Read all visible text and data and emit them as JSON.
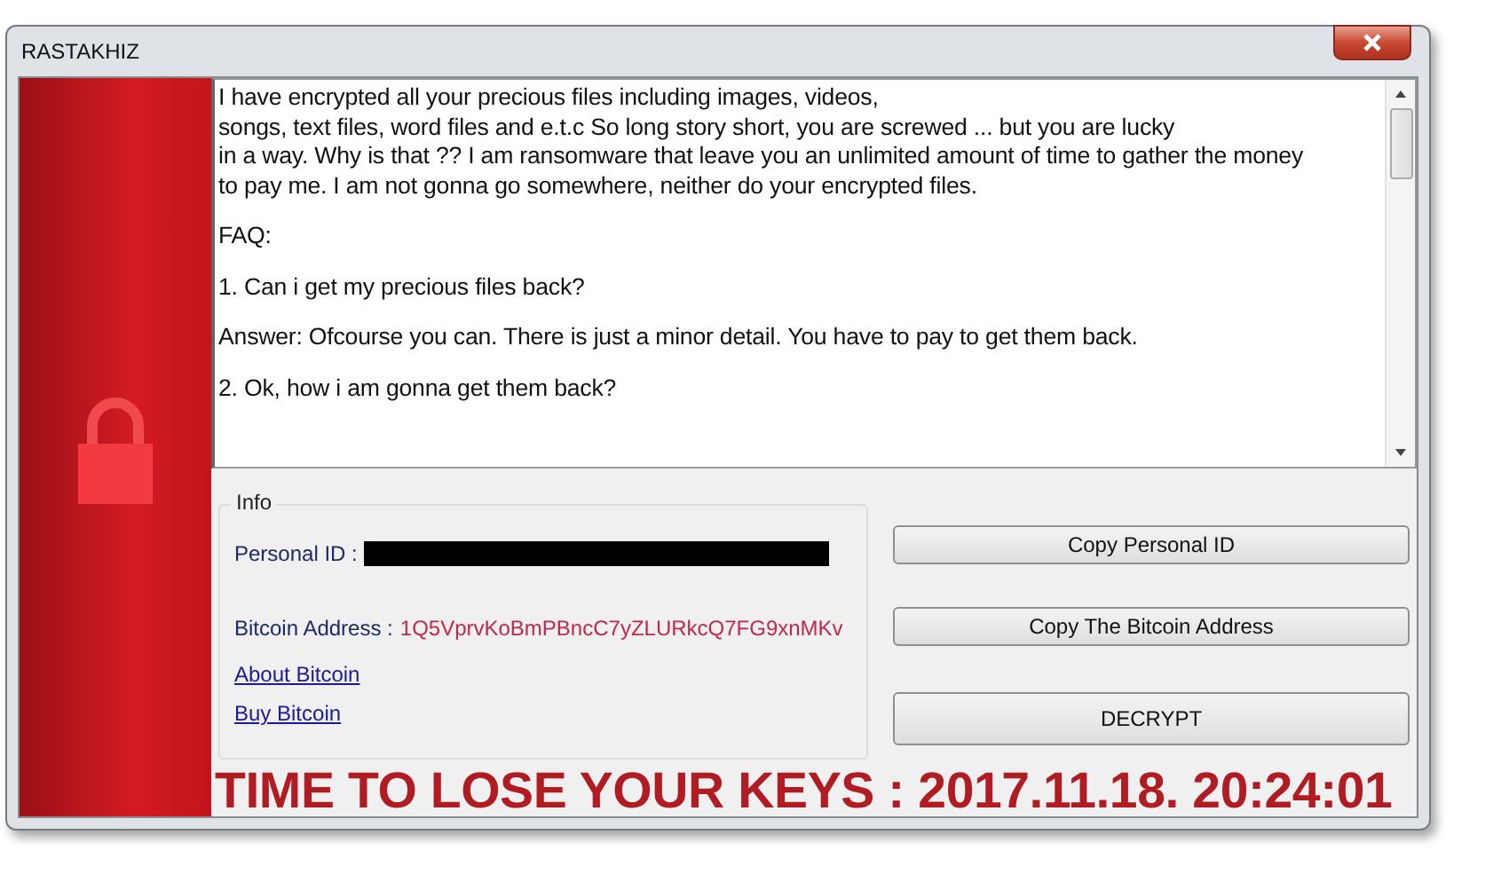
{
  "window": {
    "title": "RASTAKHIZ"
  },
  "message": {
    "paragraphs": [
      "I have encrypted all your precious files including images, videos,\nsongs, text files, word files and e.t.c  So long story short, you are screwed ... but you are lucky\nin a way. Why is that ?? I am ransomware that leave you an unlimited amount of time to gather the money\nto pay me. I am not gonna go somewhere, neither do your encrypted files.",
      "FAQ:",
      "1. Can i get my precious files back?",
      "Answer: Ofcourse you can. There is just a minor detail. You have to pay to get them back.",
      "2. Ok, how i am gonna get them back?"
    ]
  },
  "info": {
    "legend": "Info",
    "personal_id_label": "Personal ID :",
    "bitcoin_label": "Bitcoin Address :",
    "bitcoin_address": "1Q5VprvKoBmPBncC7yZLURkcQ7FG9xnMKv",
    "links": [
      "About Bitcoin",
      "Buy Bitcoin"
    ]
  },
  "buttons": [
    "Copy Personal ID",
    "Copy The Bitcoin Address",
    "DECRYPT"
  ],
  "countdown": "TIME TO LOSE YOUR KEYS : 2017.11.18. 20:24:01"
}
